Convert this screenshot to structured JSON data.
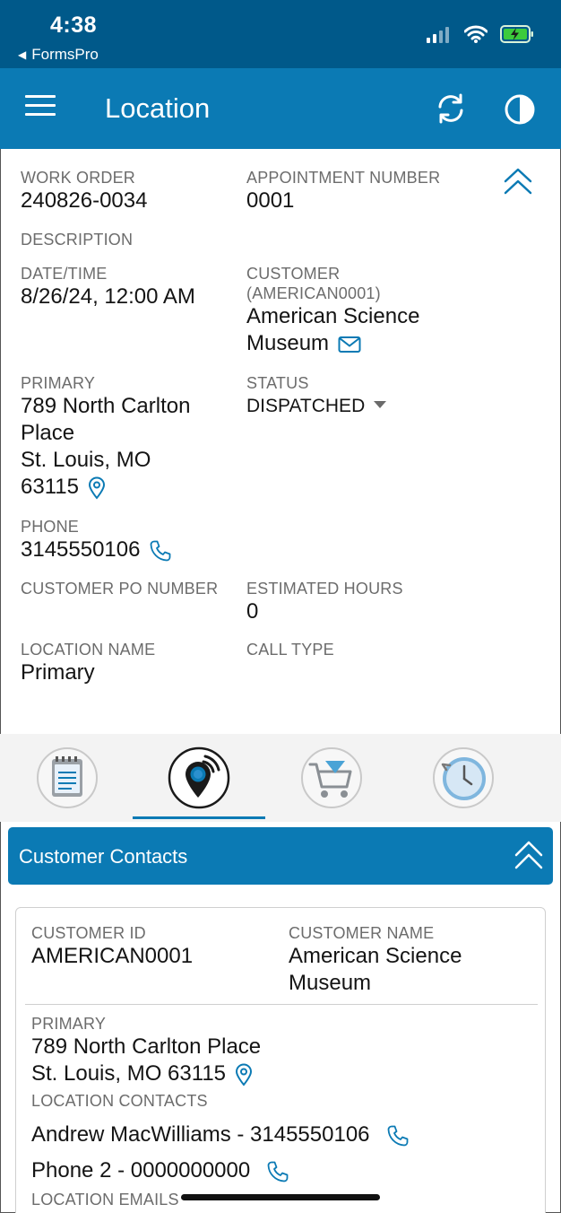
{
  "status_bar": {
    "time": "4:38",
    "back_app": "FormsPro",
    "icons": [
      "signal-icon",
      "wifi-icon",
      "battery-charging-icon"
    ]
  },
  "header": {
    "title": "Location",
    "menu_icon": "hamburger-menu-icon",
    "sync_icon": "sync-icon",
    "contrast_icon": "contrast-icon"
  },
  "details": {
    "work_order": {
      "label": "WORK ORDER",
      "value": "240826-0034"
    },
    "appointment_number": {
      "label": "APPOINTMENT NUMBER",
      "value": "0001"
    },
    "description": {
      "label": "DESCRIPTION",
      "value": ""
    },
    "date_time": {
      "label": "DATE/TIME",
      "value": "8/26/24, 12:00 AM"
    },
    "customer": {
      "label": "CUSTOMER",
      "sublabel": "(AMERICAN0001)",
      "value_line1": "American Science",
      "value_line2": "Museum"
    },
    "primary": {
      "label": "PRIMARY",
      "line1": "789 North Carlton",
      "line2": "Place",
      "line3": "St. Louis, MO",
      "line4": "63115"
    },
    "status": {
      "label": "STATUS",
      "value": "DISPATCHED"
    },
    "phone": {
      "label": "PHONE",
      "value": "3145550106"
    },
    "customer_po": {
      "label": "CUSTOMER PO NUMBER",
      "value": ""
    },
    "estimated_hours": {
      "label": "ESTIMATED HOURS",
      "value": "0"
    },
    "location_name": {
      "label": "LOCATION NAME",
      "value": "Primary"
    },
    "call_type": {
      "label": "CALL TYPE",
      "value": ""
    }
  },
  "tabs": [
    {
      "name": "notes-tab",
      "icon": "notepad-icon",
      "selected": false
    },
    {
      "name": "location-tab",
      "icon": "location-pin-icon",
      "selected": true
    },
    {
      "name": "parts-tab",
      "icon": "cart-icon",
      "selected": false
    },
    {
      "name": "time-tab",
      "icon": "clock-history-icon",
      "selected": false
    }
  ],
  "contacts": {
    "title": "Customer Contacts",
    "customer_id": {
      "label": "CUSTOMER ID",
      "value": "AMERICAN0001"
    },
    "customer_name": {
      "label": "CUSTOMER NAME",
      "value_line1": "American Science",
      "value_line2": "Museum"
    },
    "primary": {
      "label": "PRIMARY",
      "line1": "789 North Carlton Place",
      "line2": "St. Louis, MO 63115"
    },
    "location_contacts": {
      "label": "LOCATION CONTACTS",
      "items": [
        "Andrew MacWilliams - 3145550106",
        "Phone 2 - 0000000000"
      ]
    },
    "location_emails_label": "LOCATION EMAILS"
  },
  "colors": {
    "status_bar": "#00598a",
    "header": "#0b7ab4",
    "accent": "#0b7ab4",
    "battery": "#3ccb3c"
  }
}
